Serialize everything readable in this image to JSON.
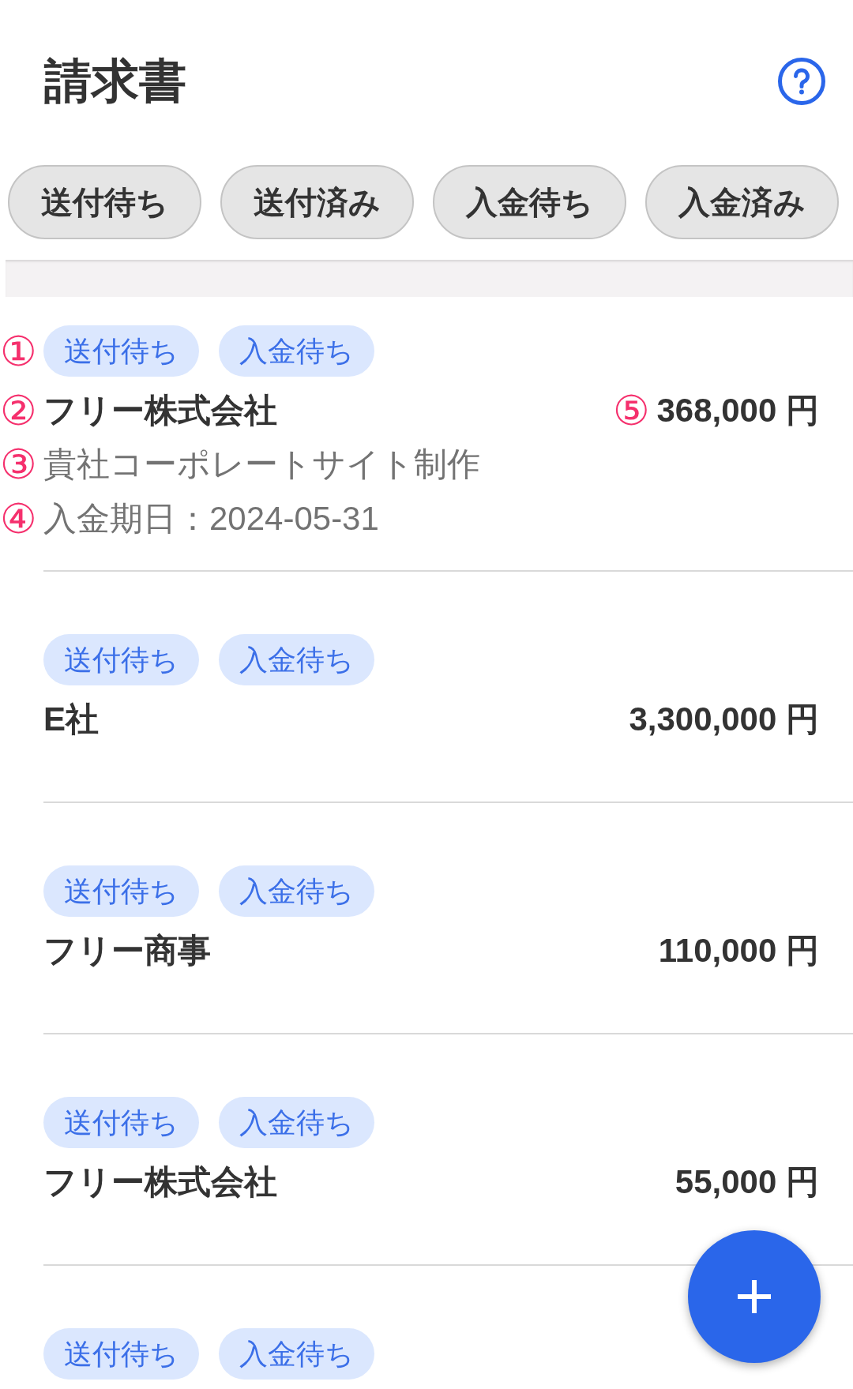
{
  "header": {
    "title": "請求書"
  },
  "filters": [
    {
      "label": "送付待ち",
      "selected": false
    },
    {
      "label": "送付済み",
      "selected": false
    },
    {
      "label": "入金待ち",
      "selected": false
    },
    {
      "label": "入金済み",
      "selected": false
    }
  ],
  "invoices": [
    {
      "tags": [
        "送付待ち",
        "入金待ち"
      ],
      "company": "フリー株式会社",
      "amount": "368,000 円",
      "description": "貴社コーポレートサイト制作",
      "due": "入金期日：2024-05-31",
      "callouts": {
        "tags": "①",
        "company": "②",
        "description": "③",
        "due": "④",
        "amount": "⑤"
      }
    },
    {
      "tags": [
        "送付待ち",
        "入金待ち"
      ],
      "company": "E社",
      "amount": "3,300,000 円"
    },
    {
      "tags": [
        "送付待ち",
        "入金待ち"
      ],
      "company": "フリー商事",
      "amount": "110,000 円"
    },
    {
      "tags": [
        "送付待ち",
        "入金待ち"
      ],
      "company": "フリー株式会社",
      "amount": "55,000 円"
    },
    {
      "tags": [
        "送付待ち",
        "入金待ち"
      ]
    }
  ]
}
